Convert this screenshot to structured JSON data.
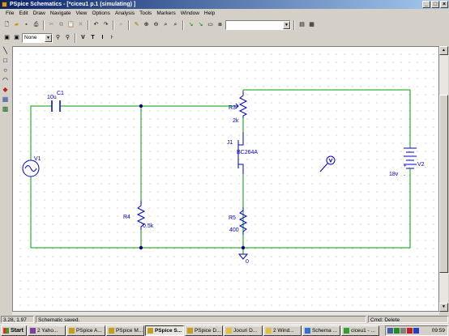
{
  "window": {
    "title": "PSpice Schematics - [*ciceu1  p.1 (simulating) ]",
    "minimize_icon": "minimize-icon",
    "maximize_icon": "maximize-icon",
    "close_icon": "close-icon"
  },
  "menu": [
    "File",
    "Edit",
    "Draw",
    "Navigate",
    "View",
    "Options",
    "Analysis",
    "Tools",
    "Markers",
    "Window",
    "Help"
  ],
  "toolbar": {
    "combo_value": "",
    "layer_combo_value": "None",
    "attr_v": "V",
    "attr_t": "T",
    "attr_i": "I"
  },
  "schematic": {
    "parts": {
      "c1_name": "C1",
      "c1_value": "10u",
      "v1_name": "V1",
      "r4_name": "R4",
      "r4_value": "0.5k",
      "r3_name": "R3",
      "r3_value": "2k",
      "j1_name": "J1",
      "j1_value": "BC264A",
      "r5_name": "R5",
      "r5_value": "400",
      "v2_name": "V2",
      "v2_value": "18v",
      "v2_plus": "+",
      "v2_minus": "-",
      "ground_label": "0"
    },
    "colors": {
      "wire": "#00a000",
      "component": "#0000c0",
      "junction": "#000080"
    }
  },
  "status": {
    "coords": "3.28, 1.97",
    "message": "Schematic saved.",
    "cmd": "Cmd: Delete"
  },
  "taskbar": {
    "start": "Start",
    "tasks": [
      "2 Yaho...",
      "PSpice A...",
      "PSpice M...",
      "PSpice S...",
      "PSpice D...",
      "Jocuri D...",
      "2 Wind...",
      "Schema ...",
      "ciceu1 - ..."
    ],
    "clock": "09:59"
  }
}
